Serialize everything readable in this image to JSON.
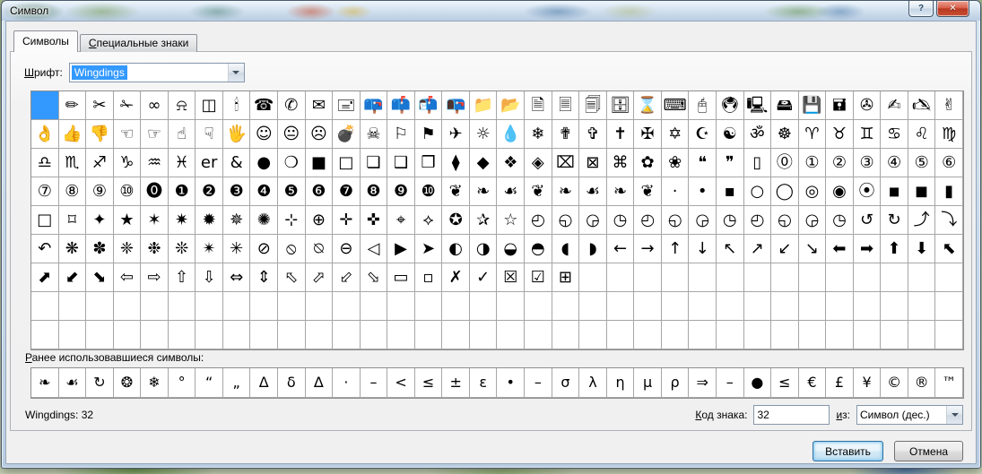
{
  "window": {
    "title": "Символ"
  },
  "icons": {
    "help": "?",
    "close": "✕"
  },
  "tabs": [
    {
      "label": "Символы",
      "active": true
    },
    {
      "label": "Специальные знаки",
      "active": false
    }
  ],
  "font_selector": {
    "label": "Шрифт:",
    "value": "Wingdings"
  },
  "symbol_grid": {
    "columns": 34,
    "rows": 9,
    "selected_index": 0,
    "cells": [
      "",
      "✏",
      "✂",
      "✁",
      "∞",
      "⍾",
      "◫",
      "🕯",
      "☎",
      "✆",
      "✉",
      "🖃",
      "📪",
      "📫",
      "📬",
      "📭",
      "📁",
      "📂",
      "🗎",
      "🗏",
      "🗐",
      "🗄",
      "⌛",
      "⌨",
      "🖰",
      "🖲",
      "🖳",
      "🖴",
      "💾",
      "🖬",
      "✇",
      "✍",
      "🖎",
      "✌",
      "👌",
      "👍",
      "👎",
      "☜",
      "☞",
      "☝",
      "☟",
      "🖐",
      "☺",
      "😐",
      "☹",
      "💣",
      "☠",
      "⚐",
      "⚑",
      "✈",
      "☼",
      "💧",
      "❄",
      "✟",
      "✞",
      "✝",
      "✠",
      "✡",
      "☪",
      "☯",
      "ॐ",
      "☸",
      "♈",
      "♉",
      "♊",
      "♋",
      "♌",
      "♍",
      "♎",
      "♏",
      "♐",
      "♑",
      "♒",
      "♓",
      "er",
      "&",
      "●",
      "❍",
      "■",
      "□",
      "❏",
      "❑",
      "❒",
      "⧫",
      "◆",
      "❖",
      "◈",
      "⌧",
      "⊠",
      "⌘",
      "✿",
      "❀",
      "❝",
      "❞",
      "▯",
      "⓪",
      "①",
      "②",
      "③",
      "④",
      "⑤",
      "⑥",
      "⑦",
      "⑧",
      "⑨",
      "⑩",
      "⓿",
      "❶",
      "❷",
      "❸",
      "❹",
      "❺",
      "❻",
      "❼",
      "❽",
      "❾",
      "❿",
      "❦",
      "❧",
      "☙",
      "❦",
      "❧",
      "☙",
      "❧",
      "❦",
      "·",
      "•",
      "▪",
      "○",
      "◯",
      "◎",
      "◉",
      "⦿",
      "◾",
      "◼",
      "▮",
      "□",
      "⌑",
      "✦",
      "★",
      "✶",
      "✷",
      "✹",
      "✵",
      "✺",
      "⊹",
      "⊕",
      "✛",
      "✜",
      "⌖",
      "⟡",
      "✪",
      "✰",
      "☆",
      "◴",
      "◵",
      "◶",
      "◷",
      "◴",
      "◵",
      "◶",
      "◷",
      "◴",
      "◵",
      "◶",
      "◷",
      "↺",
      "↻",
      "⤴",
      "⤵",
      "↶",
      "❋",
      "✽",
      "❈",
      "❉",
      "❊",
      "✴",
      "✳",
      "⊘",
      "⦸",
      "⍉",
      "⊖",
      "◁",
      "▶",
      "➤",
      "◐",
      "◑",
      "◒",
      "◓",
      "◖",
      "◗",
      "←",
      "→",
      "↑",
      "↓",
      "↖",
      "↗",
      "↙",
      "↘",
      "⬅",
      "➡",
      "⬆",
      "⬇",
      "⬉",
      "⬈",
      "⬋",
      "⬊",
      "⇦",
      "⇨",
      "⇧",
      "⇩",
      "⇔",
      "⇕",
      "⬁",
      "⬀",
      "⬃",
      "⬂",
      "▭",
      "▫",
      "✗",
      "✓",
      "☒",
      "☑",
      "⊞"
    ]
  },
  "recent": {
    "label": "Ранее использовавшиеся символы:",
    "columns": 34,
    "rows": 1,
    "cells": [
      "❧",
      "☙",
      "↻",
      "❂",
      "❄",
      "°",
      "“",
      "„",
      "Δ",
      "δ",
      "∆",
      "·",
      "–",
      "<",
      "≤",
      "±",
      "ε",
      "•",
      "–",
      "σ",
      "λ",
      "η",
      "μ",
      "ρ",
      "⇒",
      "–",
      "●",
      "≤",
      "€",
      "£",
      "¥",
      "©",
      "®",
      "™"
    ]
  },
  "status": {
    "left": "Wingdings: 32",
    "char_code_label": "Код знака:",
    "char_code_value": "32",
    "from_label": "из:",
    "from_value": "Символ (дес.)"
  },
  "buttons": {
    "insert": "Вставить",
    "cancel": "Отмена"
  },
  "colors": {
    "selection": "#3399ff"
  }
}
